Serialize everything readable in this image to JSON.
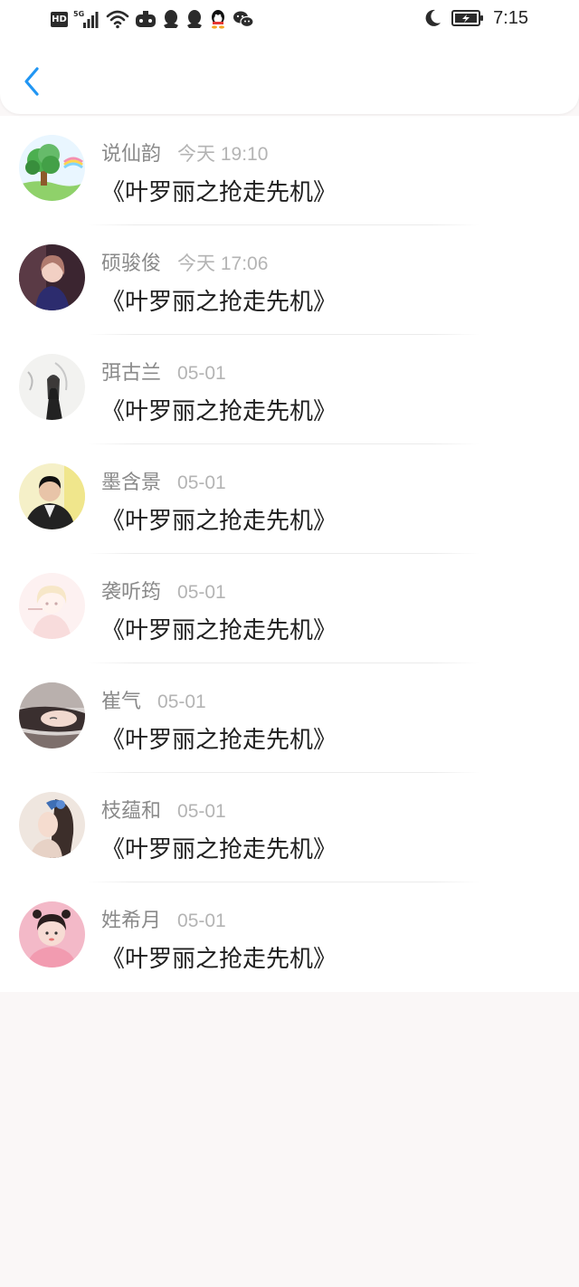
{
  "status_bar": {
    "network_badge": "HD",
    "signal_label": "5G",
    "time": "7:15",
    "icons": [
      "hd-icon",
      "5g-signal-icon",
      "wifi-icon",
      "game-icon",
      "qq-icon",
      "qq-icon",
      "qq-color-icon",
      "wechat-icon",
      "moon-icon",
      "battery-charging-icon"
    ]
  },
  "header": {
    "back_icon": "chevron-left-icon",
    "accent_color": "#2196f3"
  },
  "messages": [
    {
      "name": "说仙韵",
      "date": "今天 19:10",
      "text": "《叶罗丽之抢走先机》"
    },
    {
      "name": "硕骏俊",
      "date": "今天 17:06",
      "text": "《叶罗丽之抢走先机》"
    },
    {
      "name": "弭古兰",
      "date": "05-01",
      "text": "《叶罗丽之抢走先机》"
    },
    {
      "name": "墨含景",
      "date": "05-01",
      "text": "《叶罗丽之抢走先机》"
    },
    {
      "name": "袭听筠",
      "date": "05-01",
      "text": "《叶罗丽之抢走先机》"
    },
    {
      "name": "崔气",
      "date": "05-01",
      "text": "《叶罗丽之抢走先机》"
    },
    {
      "name": "枝蕴和",
      "date": "05-01",
      "text": "《叶罗丽之抢走先机》"
    },
    {
      "name": "姓希月",
      "date": "05-01",
      "text": "《叶罗丽之抢走先机》"
    }
  ]
}
